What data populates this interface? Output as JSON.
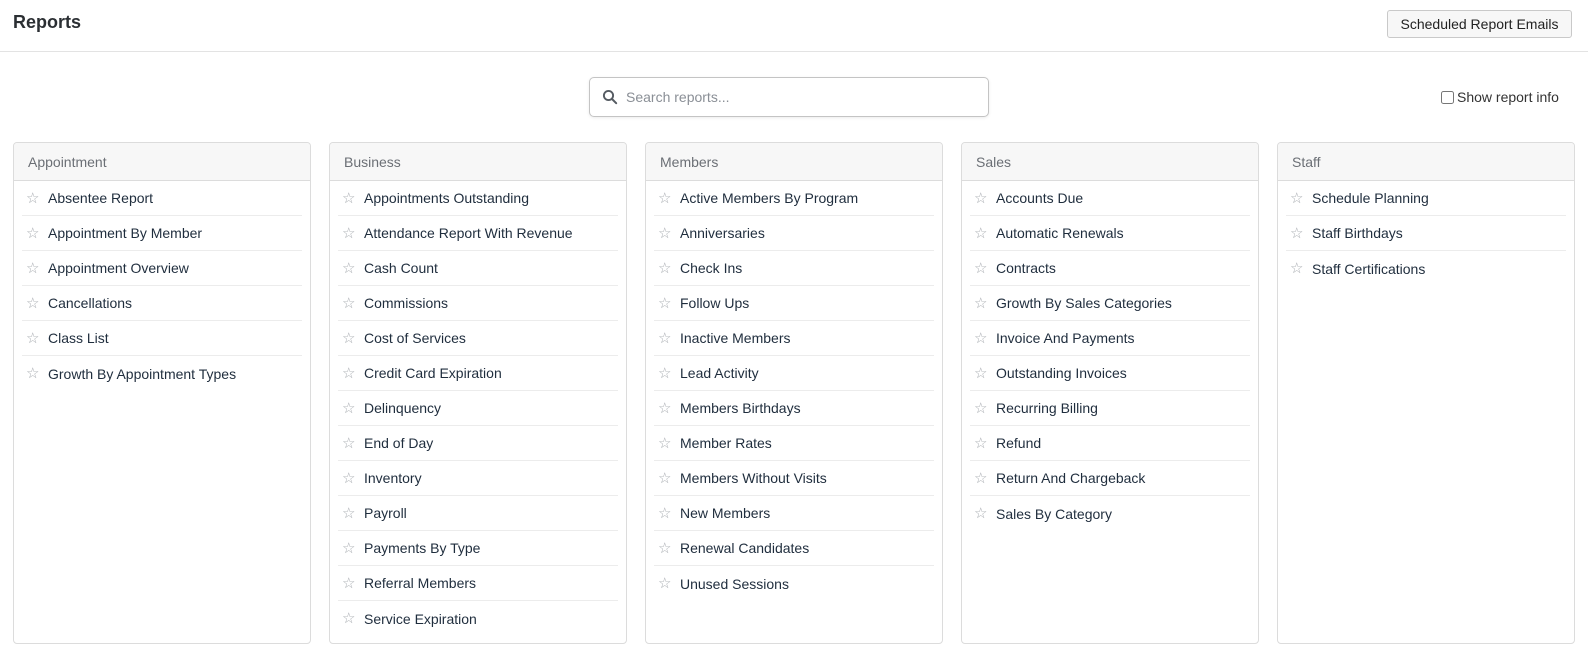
{
  "header": {
    "title": "Reports",
    "scheduled_button": "Scheduled Report Emails"
  },
  "search": {
    "placeholder": "Search reports...",
    "value": ""
  },
  "report_info": {
    "label": "Show report info",
    "checked": false
  },
  "icons": {
    "search": "search-icon",
    "favorite": "star-outline-icon"
  },
  "colors": {
    "star": "#a8acb1",
    "panel_header_bg": "#f7f7f7",
    "text": "#1f2d3d"
  },
  "categories": [
    {
      "name": "Appointment",
      "reports": [
        "Absentee Report",
        "Appointment By Member",
        "Appointment Overview",
        "Cancellations",
        "Class List",
        "Growth By Appointment Types"
      ]
    },
    {
      "name": "Business",
      "reports": [
        "Appointments Outstanding",
        "Attendance Report With Revenue",
        "Cash Count",
        "Commissions",
        "Cost of Services",
        "Credit Card Expiration",
        "Delinquency",
        "End of Day",
        "Inventory",
        "Payroll",
        "Payments By Type",
        "Referral Members",
        "Service Expiration"
      ]
    },
    {
      "name": "Members",
      "reports": [
        "Active Members By Program",
        "Anniversaries",
        "Check Ins",
        "Follow Ups",
        "Inactive Members",
        "Lead Activity",
        "Members Birthdays",
        "Member Rates",
        "Members Without Visits",
        "New Members",
        "Renewal Candidates",
        "Unused Sessions"
      ]
    },
    {
      "name": "Sales",
      "reports": [
        "Accounts Due",
        "Automatic Renewals",
        "Contracts",
        "Growth By Sales Categories",
        "Invoice And Payments",
        "Outstanding Invoices",
        "Recurring Billing",
        "Refund",
        "Return And Chargeback",
        "Sales By Category"
      ]
    },
    {
      "name": "Staff",
      "reports": [
        "Schedule Planning",
        "Staff Birthdays",
        "Staff Certifications"
      ]
    }
  ]
}
